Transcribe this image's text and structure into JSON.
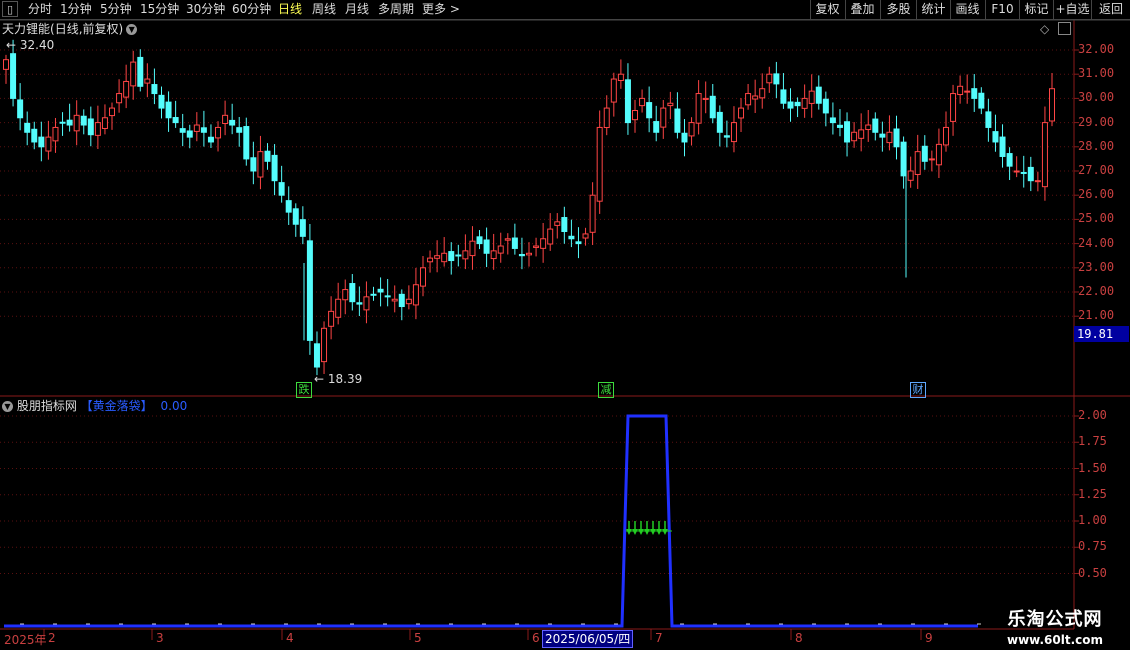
{
  "toolbar": {
    "periods": [
      "分时",
      "1分钟",
      "5分钟",
      "15分钟",
      "30分钟",
      "60分钟",
      "日线",
      "周线",
      "月线",
      "多周期",
      "更多"
    ],
    "active_period": "日线",
    "right_buttons": [
      "复权",
      "叠加",
      "多股",
      "统计",
      "画线",
      "F10",
      "标记",
      "+自选",
      "返回"
    ]
  },
  "stock": {
    "name": "天力锂能",
    "mode": "(日线,前复权)",
    "high_label": "32.40",
    "low_label": "18.39",
    "current_price": "19.81"
  },
  "price_axis": [
    "32.00",
    "31.00",
    "30.00",
    "29.00",
    "28.00",
    "27.00",
    "26.00",
    "25.00",
    "24.00",
    "23.00",
    "22.00",
    "21.00"
  ],
  "markers": [
    {
      "text": "跌",
      "color": "#3ddb3d"
    },
    {
      "text": "减",
      "color": "#3ddb3d"
    },
    {
      "text": "财",
      "color": "#5fa8ff"
    }
  ],
  "indicator": {
    "name": "股朋指标网",
    "formula": "【黄金落袋】",
    "value": "0.00",
    "axis": [
      "2.00",
      "1.75",
      "1.50",
      "1.25",
      "1.00",
      "0.75",
      "0.50"
    ]
  },
  "date_axis": {
    "year": "2025年",
    "months": [
      "2",
      "3",
      "4",
      "5",
      "6",
      "7",
      "8",
      "9"
    ],
    "selected_date": "2025/06/05/四"
  },
  "watermark": {
    "line1": "乐淘公式网",
    "line2": "www.60lt.com"
  },
  "colors": {
    "up": "#ff4545",
    "down": "#54fcfc",
    "indicator": "#2030ff",
    "arrow": "#22cc22",
    "grid": "#8a1a1a"
  }
}
